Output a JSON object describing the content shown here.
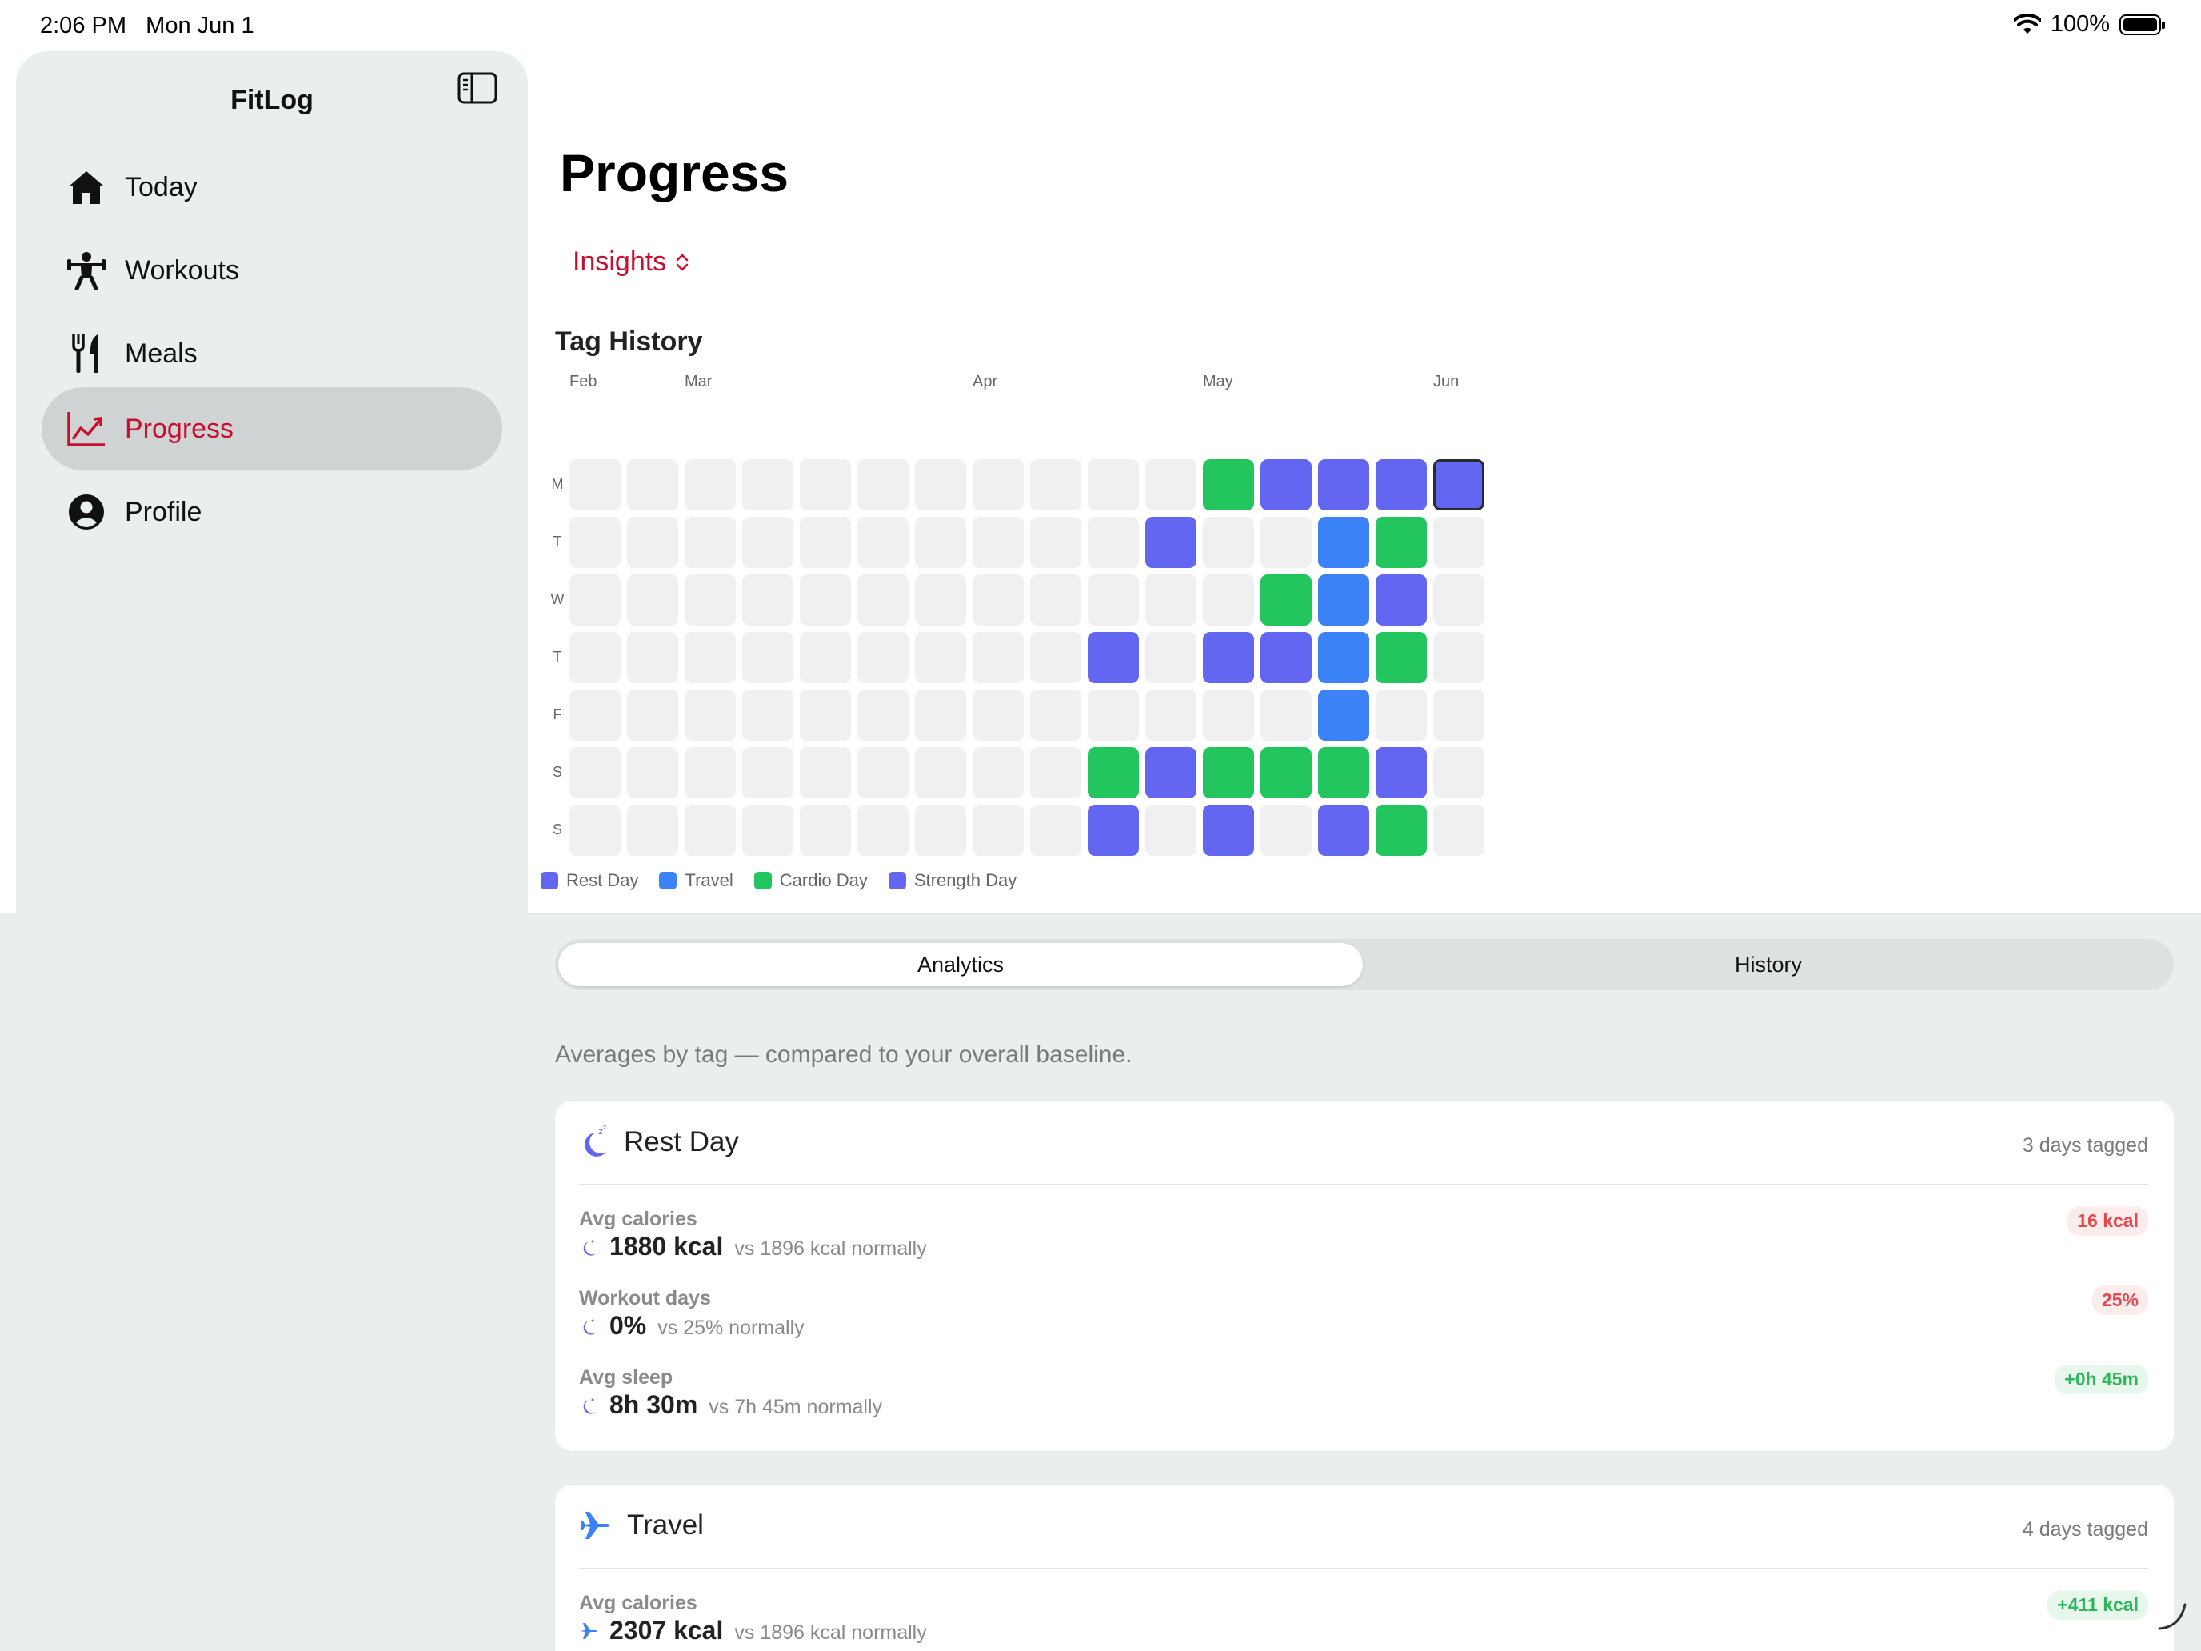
{
  "status": {
    "time": "2:06 PM   Mon Jun 1",
    "battery": "100%"
  },
  "sidebar": {
    "title": "FitLog",
    "items": [
      {
        "label": "Today",
        "icon": "house-icon"
      },
      {
        "label": "Workouts",
        "icon": "weightlifter-icon"
      },
      {
        "label": "Meals",
        "icon": "fork-knife-icon"
      },
      {
        "label": "Progress",
        "icon": "chart-line-icon",
        "active": true
      },
      {
        "label": "Profile",
        "icon": "person-circle-icon"
      }
    ]
  },
  "header": {
    "title": "Progress",
    "picker_label": "Insights"
  },
  "tag_history": {
    "title": "Tag History",
    "months": [
      "Feb",
      "Mar",
      "Apr",
      "May",
      "Jun"
    ],
    "days": [
      "M",
      "T",
      "W",
      "T",
      "F",
      "S",
      "S"
    ],
    "grid": [
      [
        null,
        null,
        null,
        null,
        null,
        null,
        null
      ],
      [
        null,
        null,
        null,
        null,
        null,
        null,
        null
      ],
      [
        null,
        null,
        null,
        null,
        null,
        null,
        null
      ],
      [
        null,
        null,
        null,
        null,
        null,
        null,
        null
      ],
      [
        null,
        null,
        null,
        null,
        null,
        null,
        null
      ],
      [
        null,
        null,
        null,
        null,
        null,
        null,
        null
      ],
      [
        null,
        null,
        null,
        null,
        null,
        null,
        null
      ],
      [
        null,
        null,
        null,
        null,
        null,
        null,
        null
      ],
      [
        null,
        null,
        null,
        null,
        null,
        null,
        null
      ],
      [
        null,
        null,
        null,
        "strength",
        null,
        "cardio",
        "strength"
      ],
      [
        null,
        "strength",
        null,
        null,
        null,
        "strength",
        null
      ],
      [
        "cardio",
        null,
        null,
        "strength",
        null,
        "cardio",
        "strength"
      ],
      [
        "strength",
        null,
        "cardio",
        "strength",
        null,
        "cardio",
        null
      ],
      [
        "strength",
        "travel",
        "travel",
        "travel",
        "travel",
        "cardio",
        "strength"
      ],
      [
        "strength",
        "cardio",
        "strength",
        "cardio",
        null,
        "strength",
        "cardio"
      ],
      [
        "strength",
        null,
        null,
        null,
        null,
        null,
        null
      ]
    ],
    "current_week": 15,
    "current_day": 0,
    "legend": [
      {
        "label": "Rest Day",
        "color": "#6366f1"
      },
      {
        "label": "Travel",
        "color": "#3b82f6"
      },
      {
        "label": "Cardio Day",
        "color": "#22c55e"
      },
      {
        "label": "Strength Day",
        "color": "#6366f1"
      }
    ],
    "colors": {
      "strength": "#6366f1",
      "travel": "#3b82f6",
      "cardio": "#22c55e",
      "empty": "#f0f0f0"
    }
  },
  "tabs": {
    "analytics": "Analytics",
    "history": "History",
    "selected": "Analytics"
  },
  "caption": "Averages by tag — compared to your overall baseline.",
  "cards": [
    {
      "name": "Rest Day",
      "icon": "moon-zzz-icon",
      "count": "3 days tagged",
      "metrics": [
        {
          "label": "Avg calories",
          "value": "1880 kcal",
          "compare": "vs 1896 kcal normally",
          "delta": "16 kcal",
          "trend": "neg"
        },
        {
          "label": "Workout days",
          "value": "0%",
          "compare": "vs 25% normally",
          "delta": "25%",
          "trend": "neg"
        },
        {
          "label": "Avg sleep",
          "value": "8h 30m",
          "compare": "vs 7h 45m normally",
          "delta": "+0h 45m",
          "trend": "pos"
        }
      ]
    },
    {
      "name": "Travel",
      "icon": "airplane-icon",
      "count": "4 days tagged",
      "metrics": [
        {
          "label": "Avg calories",
          "value": "2307 kcal",
          "compare": "vs 1896 kcal normally",
          "delta": "+411 kcal",
          "trend": "pos"
        }
      ]
    }
  ]
}
